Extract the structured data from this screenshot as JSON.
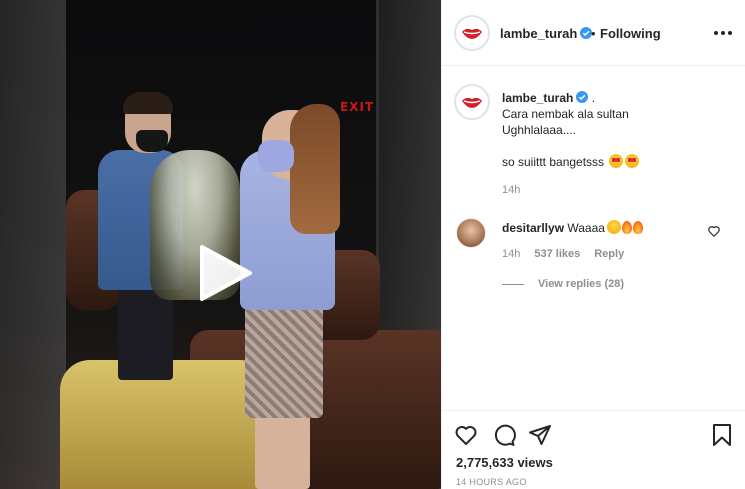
{
  "media": {
    "sign_text": "EXIT"
  },
  "post": {
    "username": "lambe_turah",
    "separator": "•",
    "follow_status": "Following"
  },
  "caption": {
    "username": "lambe_turah",
    "trailing": ".",
    "line1": "Cara nembak ala sultan",
    "line2": "Ughhlalaaa....",
    "line3": "so suiittt bangetsss",
    "time": "14h"
  },
  "comment": {
    "username": "desitarllyw",
    "text": "Waaaa",
    "time": "14h",
    "likes": "537 likes",
    "reply": "Reply",
    "view_replies": "View replies (28)"
  },
  "footer": {
    "views": "2,775,633 views",
    "posted": "14 HOURS AGO"
  },
  "colors": {
    "text": "#262626",
    "muted": "#8e8e8e",
    "verified": "#3897f0",
    "brand_lips": "#d0202a"
  }
}
